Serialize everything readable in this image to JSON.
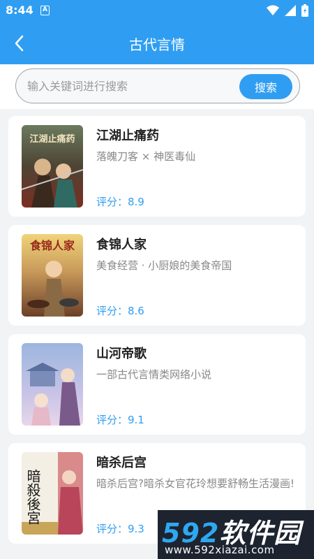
{
  "status": {
    "time": "8:44",
    "notif_letter": "A"
  },
  "app_bar": {
    "title": "古代言情"
  },
  "search": {
    "placeholder": "输入关键词进行搜索",
    "button_label": "搜索"
  },
  "books": [
    {
      "title": "江湖止痛药",
      "description": "落魄刀客 × 神医毒仙",
      "score": "评分：8.9",
      "cover_text": "江湖止痛药"
    },
    {
      "title": "食锦人家",
      "description": "美食经营 · 小厨娘的美食帝国",
      "score": "评分：8.6",
      "cover_text": "食锦人家"
    },
    {
      "title": "山河帝歌",
      "description": "一部古代言情类网络小说",
      "score": "评分：9.1",
      "cover_text": ""
    },
    {
      "title": "暗杀后宫",
      "description": "暗杀后宫?暗杀女官花玲想要舒畅生活漫画!",
      "score": "评分：9.3",
      "cover_text": "暗殺後宮"
    }
  ],
  "watermark": {
    "brand_num": "592",
    "brand_cn": "软件园",
    "url": "www.592xiazai.com"
  },
  "colors": {
    "accent": "#2f9ef2",
    "background": "#f2f3f5"
  }
}
